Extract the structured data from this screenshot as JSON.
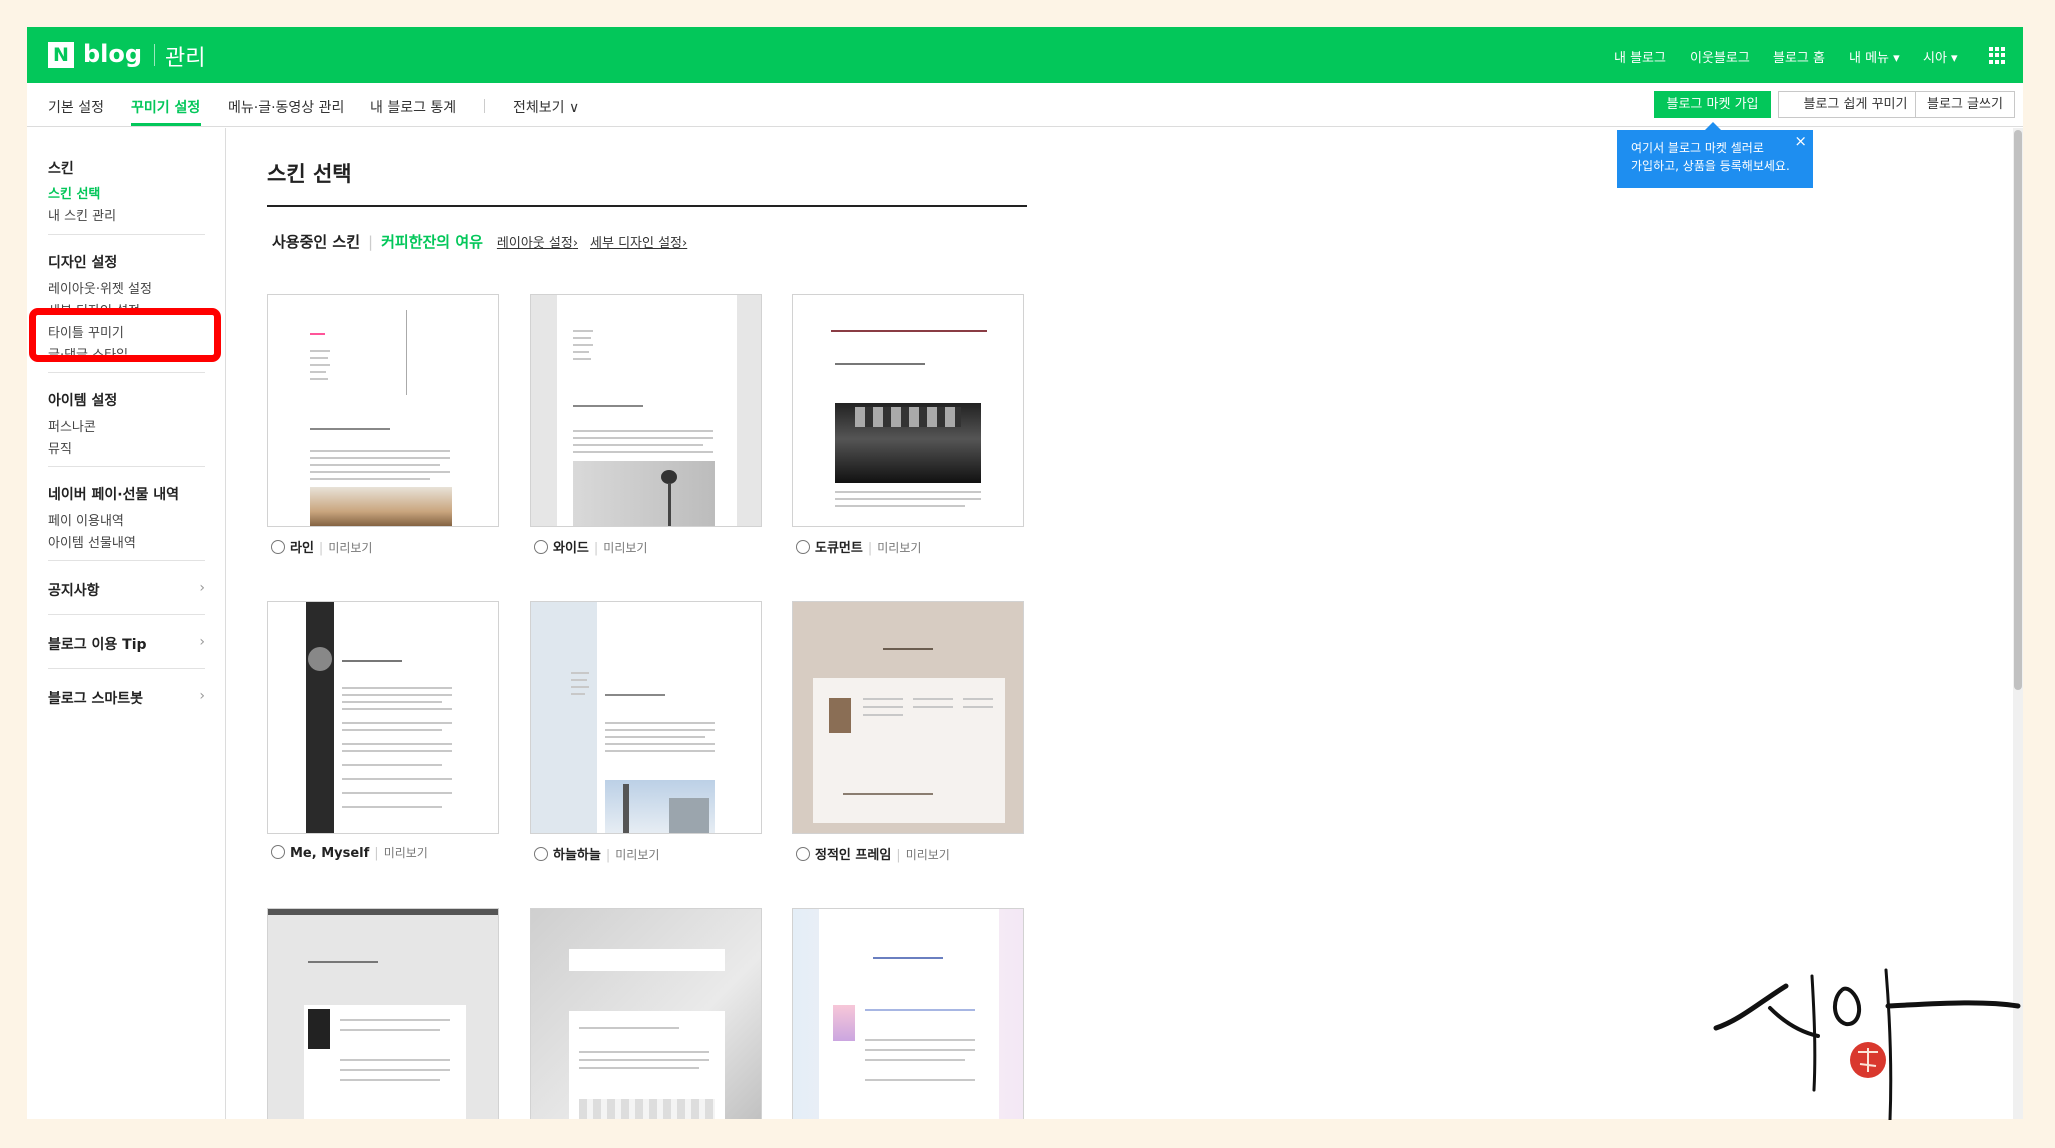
{
  "header": {
    "logo_n": "N",
    "logo_blog": "blog",
    "admin_label": "관리",
    "nav": [
      "내 블로그",
      "이웃블로그",
      "블로그 홈",
      "내 메뉴 ▾",
      "시아 ▾"
    ]
  },
  "tabs": [
    "기본 설정",
    "꾸미기 설정",
    "메뉴·글·동영상 관리",
    "내 블로그 통계",
    "전체보기 ∨"
  ],
  "top_buttons": [
    "블로그 마켓 가입",
    "블로그 쉽게 꾸미기",
    "블로그 글쓰기"
  ],
  "tooltip": {
    "line1": "여기서 블로그 마켓 셀러로",
    "line2": "가입하고, 상품을 등록해보세요.",
    "close": "×"
  },
  "sidebar": {
    "skin_title": "스킨",
    "skin_items": [
      "스킨 선택",
      "내 스킨 관리"
    ],
    "design_title": "디자인 설정",
    "design_items": [
      "레이아웃·위젯 설정",
      "세부 디자인 설정",
      "타이틀 꾸미기",
      "글·댓글 스타일"
    ],
    "item_title": "아이템 설정",
    "item_items": [
      "퍼스나콘",
      "뮤직"
    ],
    "pay_title": "네이버 페이·선물 내역",
    "pay_items": [
      "페이 이용내역",
      "아이템 선물내역"
    ],
    "links": [
      "공지사항",
      "블로그 이용 Tip",
      "블로그 스마트봇"
    ],
    "chevron": "›"
  },
  "main": {
    "title": "스킨 선택",
    "using_label": "사용중인 스킨",
    "using_name": "커피한잔의 여유",
    "layout_link": "레이아웃 설정",
    "detail_link": "세부 디자인 설정",
    "link_arrow": "›",
    "preview_label": "미리보기",
    "skins": [
      "라인",
      "와이드",
      "도큐먼트",
      "Me, Myself",
      "하늘하늘",
      "정적인 프레임",
      "",
      "",
      ""
    ]
  },
  "watermark": "시아",
  "colors": {
    "brand_green": "#03c75a",
    "tooltip_blue": "#1e8ef0",
    "highlight_red": "#ff0000",
    "frame_bg": "#fdf4e6"
  }
}
